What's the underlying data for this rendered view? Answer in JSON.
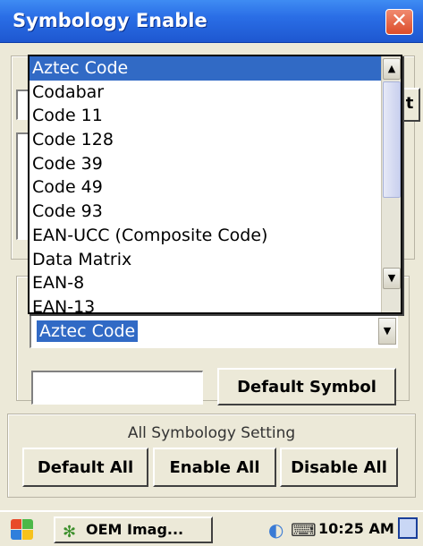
{
  "window": {
    "title": "Symbology Enable",
    "close_label": "✕"
  },
  "dropdown": {
    "items": [
      "Aztec Code",
      "Codabar",
      "Code 11",
      "Code 128",
      "Code 39",
      "Code 49",
      "Code 93",
      "EAN-UCC (Composite Code)",
      "Data Matrix",
      "EAN-8",
      "EAN-13"
    ],
    "selected_index": 0,
    "scroll_up": "▲",
    "scroll_down": "▼"
  },
  "combo": {
    "value": "Aztec Code",
    "arrow": "▼"
  },
  "buttons": {
    "default_symbol": "Default Symbol",
    "default_all": "Default All",
    "enable_all": "Enable All",
    "disable_all": "Disable All"
  },
  "group": {
    "all_symbology_label": "All Symbology Setting"
  },
  "background_fragments": {
    "top_edge_text": "t"
  },
  "taskbar": {
    "app_button": "OEM Imag...",
    "clock": "10:25 AM"
  }
}
